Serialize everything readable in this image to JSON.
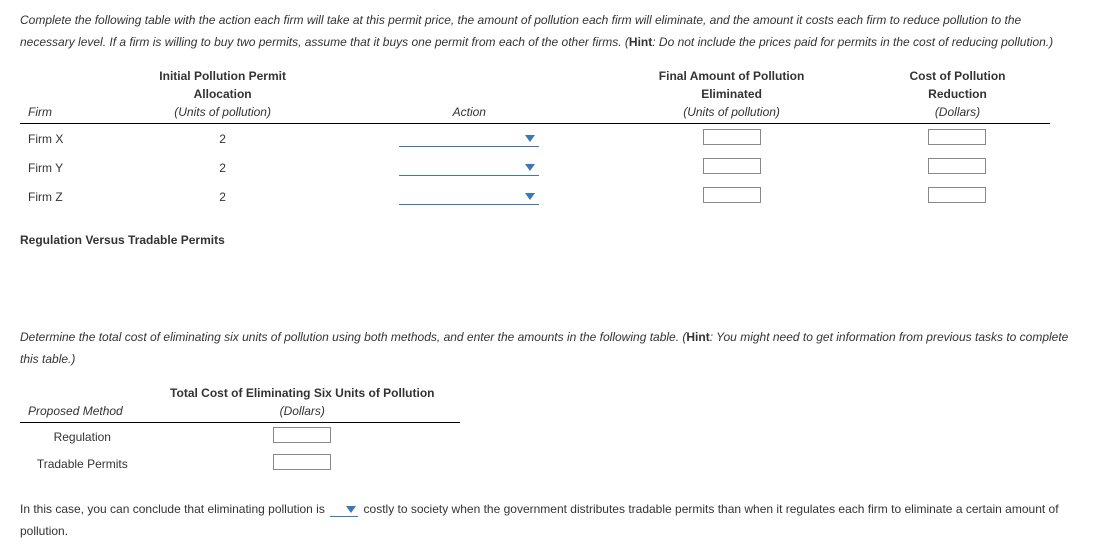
{
  "intro": {
    "line1": "Complete the following table with the action each firm will take at this permit price, the amount of pollution each firm will eliminate, and the amount it costs each firm to reduce pollution to the necessary level. If a firm is willing to buy two permits, assume that it buys one permit from each of the other firms. (",
    "hintLabel": "Hint",
    "hintText": ": Do not include the prices paid for permits in the cost of reducing pollution.)"
  },
  "table1": {
    "h_firm": "Firm",
    "h_alloc1": "Initial Pollution Permit",
    "h_alloc2": "Allocation",
    "h_alloc_sub": "(Units of pollution)",
    "h_action": "Action",
    "h_final1": "Final Amount of Pollution",
    "h_final2": "Eliminated",
    "h_final_sub": "(Units of pollution)",
    "h_cost1": "Cost of Pollution",
    "h_cost2": "Reduction",
    "h_cost_sub": "(Dollars)",
    "rows": [
      {
        "firm": "Firm X",
        "alloc": "2"
      },
      {
        "firm": "Firm Y",
        "alloc": "2"
      },
      {
        "firm": "Firm Z",
        "alloc": "2"
      }
    ]
  },
  "section": "Regulation Versus Tradable Permits",
  "intro2": {
    "line1": "Determine the total cost of eliminating six units of pollution using both methods, and enter the amounts in the following table. (",
    "hintLabel": "Hint",
    "hintText": ": You might need to get information from previous tasks to complete this table.)"
  },
  "table2": {
    "h_method": "Proposed Method",
    "h_cost1": "Total Cost of Eliminating Six Units of Pollution",
    "h_cost_sub": "(Dollars)",
    "rows": [
      {
        "method": "Regulation"
      },
      {
        "method": "Tradable Permits"
      }
    ]
  },
  "conclusion": {
    "part1": "In this case, you can conclude that eliminating pollution is ",
    "part2": " costly to society when the government distributes tradable permits than when it regulates each firm to eliminate a certain amount of pollution."
  }
}
